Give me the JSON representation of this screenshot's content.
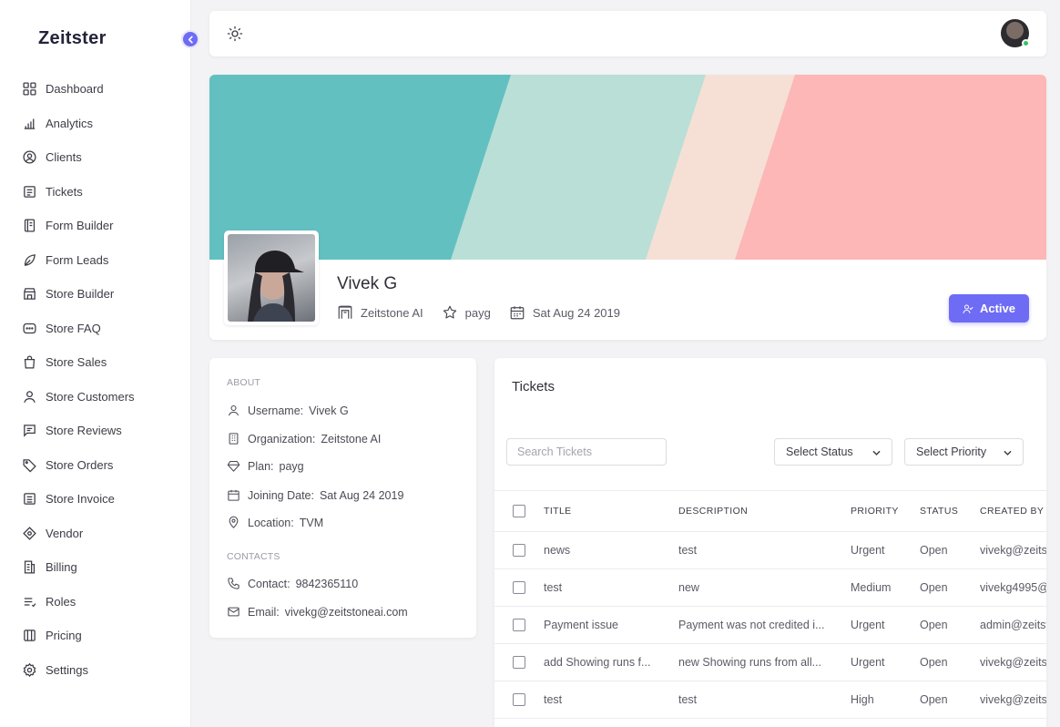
{
  "brand": {
    "logo_text": "Zeitster"
  },
  "sidebar": {
    "items": [
      {
        "label": "Dashboard",
        "icon": "dashboard-icon"
      },
      {
        "label": "Analytics",
        "icon": "analytics-icon"
      },
      {
        "label": "Clients",
        "icon": "clients-icon"
      },
      {
        "label": "Tickets",
        "icon": "tickets-icon"
      },
      {
        "label": "Form Builder",
        "icon": "form-builder-icon"
      },
      {
        "label": "Form Leads",
        "icon": "form-leads-icon"
      },
      {
        "label": "Store Builder",
        "icon": "store-builder-icon"
      },
      {
        "label": "Store FAQ",
        "icon": "store-faq-icon"
      },
      {
        "label": "Store Sales",
        "icon": "store-sales-icon"
      },
      {
        "label": "Store Customers",
        "icon": "store-customers-icon"
      },
      {
        "label": "Store Reviews",
        "icon": "store-reviews-icon"
      },
      {
        "label": "Store Orders",
        "icon": "store-orders-icon"
      },
      {
        "label": "Store Invoice",
        "icon": "store-invoice-icon"
      },
      {
        "label": "Vendor",
        "icon": "vendor-icon"
      },
      {
        "label": "Billing",
        "icon": "billing-icon"
      },
      {
        "label": "Roles",
        "icon": "roles-icon"
      },
      {
        "label": "Pricing",
        "icon": "pricing-icon"
      },
      {
        "label": "Settings",
        "icon": "settings-icon"
      }
    ]
  },
  "profile": {
    "name": "Vivek G",
    "organization": "Zeitstone AI",
    "plan": "payg",
    "joined": "Sat Aug 24 2019",
    "status_label": "Active"
  },
  "about": {
    "section_title": "ABOUT",
    "rows": [
      {
        "key": "Username:",
        "value": "Vivek G",
        "icon": "user-icon"
      },
      {
        "key": "Organization:",
        "value": "Zeitstone AI",
        "icon": "building-icon"
      },
      {
        "key": "Plan:",
        "value": "payg",
        "icon": "diamond-icon"
      },
      {
        "key": "Joining Date:",
        "value": "Sat Aug 24 2019",
        "icon": "calendar-icon"
      },
      {
        "key": "Location:",
        "value": "TVM",
        "icon": "map-pin-icon"
      }
    ],
    "contacts_title": "CONTACTS",
    "contacts": [
      {
        "key": "Contact:",
        "value": "9842365110",
        "icon": "phone-icon"
      },
      {
        "key": "Email:",
        "value": "vivekg@zeitstoneai.com",
        "icon": "mail-icon"
      }
    ]
  },
  "tickets": {
    "title": "Tickets",
    "search_placeholder": "Search Tickets",
    "status_select": "Select Status",
    "priority_select": "Select Priority",
    "columns": [
      "TITLE",
      "DESCRIPTION",
      "PRIORITY",
      "STATUS",
      "CREATED BY"
    ],
    "rows": [
      {
        "title": "news",
        "description": "test",
        "priority": "Urgent",
        "status": "Open",
        "created_by": "vivekg@zeits"
      },
      {
        "title": "test",
        "description": "new",
        "priority": "Medium",
        "status": "Open",
        "created_by": "vivekg4995@"
      },
      {
        "title": "Payment issue",
        "description": "Payment was not credited i...",
        "priority": "Urgent",
        "status": "Open",
        "created_by": "admin@zeitst"
      },
      {
        "title": "add Showing runs f...",
        "description": "new Showing runs from all...",
        "priority": "Urgent",
        "status": "Open",
        "created_by": "vivekg@zeits"
      },
      {
        "title": "test",
        "description": "test",
        "priority": "High",
        "status": "Open",
        "created_by": "vivekg@zeits"
      }
    ]
  },
  "colors": {
    "accent": "#6e6bf5",
    "banner_teal": "#62c0c1",
    "banner_mint": "#badfd7",
    "banner_peach": "#f6e0d6",
    "banner_pink": "#fcb7b6",
    "online": "#34c46b"
  }
}
